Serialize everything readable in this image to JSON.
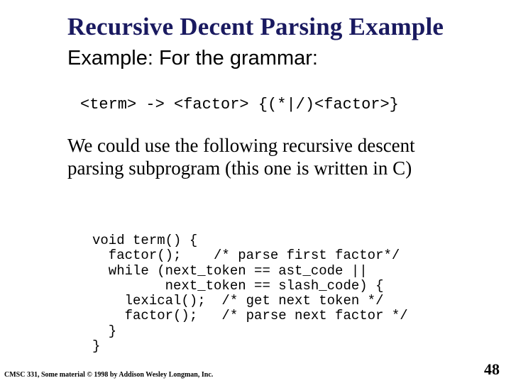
{
  "title": "Recursive Decent Parsing Example",
  "subtitle": "Example: For the grammar:",
  "grammar_line": "<term> -> <factor> {(*|/)<factor>}",
  "body_text": "We could use the following recursive descent parsing subprogram (this one is written in C)",
  "code_lines": [
    "void term() {",
    "  factor();    /* parse first factor*/",
    "  while (next_token == ast_code ||",
    "         next_token == slash_code) {",
    "    lexical();  /* get next token */",
    "    factor();   /* parse next factor */",
    "  }",
    "}"
  ],
  "footer_left": "CMSC 331, Some material © 1998 by Addison Wesley Longman, Inc.",
  "footer_right": "48"
}
